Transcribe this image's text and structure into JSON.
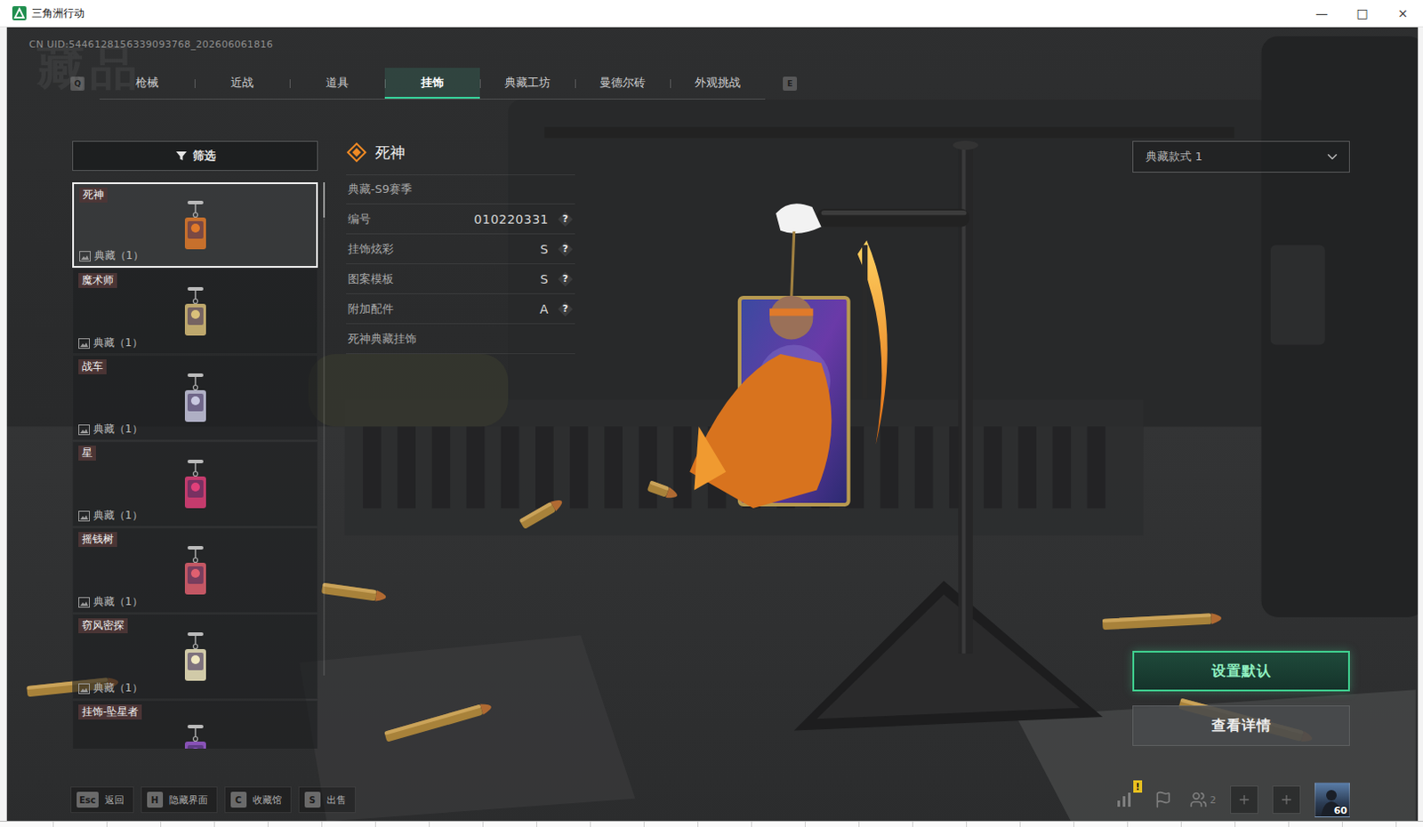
{
  "window": {
    "title": "三角洲行动",
    "controls": [
      "—",
      "□",
      "×"
    ]
  },
  "uid": "CN UID:5446128156339093768_202606061816",
  "watermark": "藏品",
  "tabs": {
    "prev_key": "Q",
    "next_key": "E",
    "items": [
      {
        "label": "枪械",
        "selected": false
      },
      {
        "label": "近战",
        "selected": false
      },
      {
        "label": "道具",
        "selected": false
      },
      {
        "label": "挂饰",
        "selected": true
      },
      {
        "label": "典藏工坊",
        "selected": false
      },
      {
        "label": "曼德尔砖",
        "selected": false
      },
      {
        "label": "外观挑战",
        "selected": false
      }
    ]
  },
  "filter": {
    "label": "筛选"
  },
  "items": [
    {
      "tag": "死神",
      "count": "典藏（1）",
      "selected": true,
      "color": "#e07a2a"
    },
    {
      "tag": "魔术师",
      "count": "典藏（1）",
      "selected": false,
      "color": "#d9c07a"
    },
    {
      "tag": "战车",
      "count": "典藏（1）",
      "selected": false,
      "color": "#c8c8e0"
    },
    {
      "tag": "星",
      "count": "典藏（1）",
      "selected": false,
      "color": "#e0407a"
    },
    {
      "tag": "摇钱树",
      "count": "典藏（1）",
      "selected": false,
      "color": "#e06070"
    },
    {
      "tag": "窃风密探",
      "count": "典藏（1）",
      "selected": false,
      "color": "#f0e8c0"
    },
    {
      "tag": "挂饰-坠星者",
      "selected": false,
      "color": "#9a5ad0"
    }
  ],
  "detail": {
    "title": "死神",
    "season": "典藏-S9赛季",
    "stats": [
      {
        "label": "编号",
        "value": "010220331",
        "help": "?"
      },
      {
        "label": "挂饰炫彩",
        "value": "S",
        "help": "?"
      },
      {
        "label": "图案模板",
        "value": "S",
        "help": "?"
      },
      {
        "label": "附加配件",
        "value": "A",
        "help": "?"
      }
    ],
    "description": "死神典藏挂饰"
  },
  "style_select": {
    "value": "典藏款式 1"
  },
  "buttons": [
    {
      "label": "设置默认",
      "kind": "primary"
    },
    {
      "label": "查看详情",
      "kind": "secondary"
    }
  ],
  "hotkeys": [
    {
      "key": "Esc",
      "label": "返回"
    },
    {
      "key": "H",
      "label": "隐藏界面"
    },
    {
      "key": "C",
      "label": "收藏馆"
    },
    {
      "key": "S",
      "label": "出售"
    }
  ],
  "tray": {
    "alert": "!",
    "party_count": "2",
    "level": "60"
  }
}
